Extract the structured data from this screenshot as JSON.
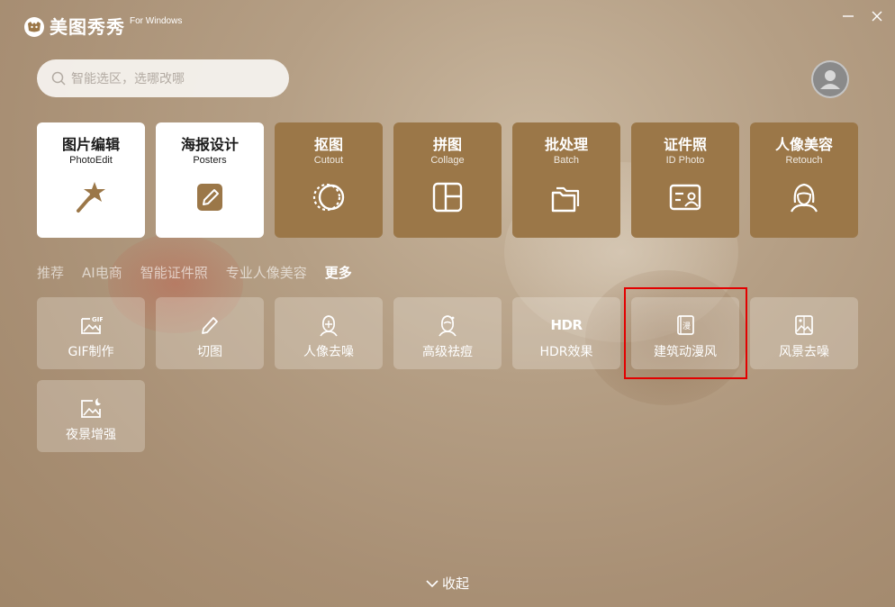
{
  "app": {
    "name": "美图秀秀",
    "platform": "For Windows"
  },
  "search": {
    "placeholder": "智能选区，选哪改哪"
  },
  "main_tools": [
    {
      "title": "图片编辑",
      "subtitle": "PhotoEdit",
      "icon": "magic-wand-icon",
      "style": "white"
    },
    {
      "title": "海报设计",
      "subtitle": "Posters",
      "icon": "pencil-square-icon",
      "style": "white"
    },
    {
      "title": "抠图",
      "subtitle": "Cutout",
      "icon": "cutout-icon",
      "style": "brown"
    },
    {
      "title": "拼图",
      "subtitle": "Collage",
      "icon": "collage-icon",
      "style": "brown"
    },
    {
      "title": "批处理",
      "subtitle": "Batch",
      "icon": "folder-icon",
      "style": "brown"
    },
    {
      "title": "证件照",
      "subtitle": "ID Photo",
      "icon": "id-card-icon",
      "style": "brown"
    },
    {
      "title": "人像美容",
      "subtitle": "Retouch",
      "icon": "portrait-icon",
      "style": "brown"
    }
  ],
  "tabs": [
    {
      "label": "推荐",
      "active": false
    },
    {
      "label": "AI电商",
      "active": false
    },
    {
      "label": "智能证件照",
      "active": false
    },
    {
      "label": "专业人像美容",
      "active": false
    },
    {
      "label": "更多",
      "active": true
    }
  ],
  "tools": [
    {
      "label": "GIF制作",
      "icon": "gif-icon"
    },
    {
      "label": "切图",
      "icon": "pen-icon"
    },
    {
      "label": "人像去噪",
      "icon": "portrait-denoise-icon"
    },
    {
      "label": "高级祛痘",
      "icon": "acne-removal-icon"
    },
    {
      "label": "HDR效果",
      "icon": "hdr-icon",
      "icon_text": "HDR"
    },
    {
      "label": "建筑动漫风",
      "icon": "anime-book-icon",
      "icon_text": "漫"
    },
    {
      "label": "风景去噪",
      "icon": "landscape-denoise-icon"
    },
    {
      "label": "夜景增强",
      "icon": "night-scene-icon"
    }
  ],
  "collapse_label": "收起",
  "colors": {
    "tile_brown": "#9b7748",
    "highlight": "#e30000"
  }
}
